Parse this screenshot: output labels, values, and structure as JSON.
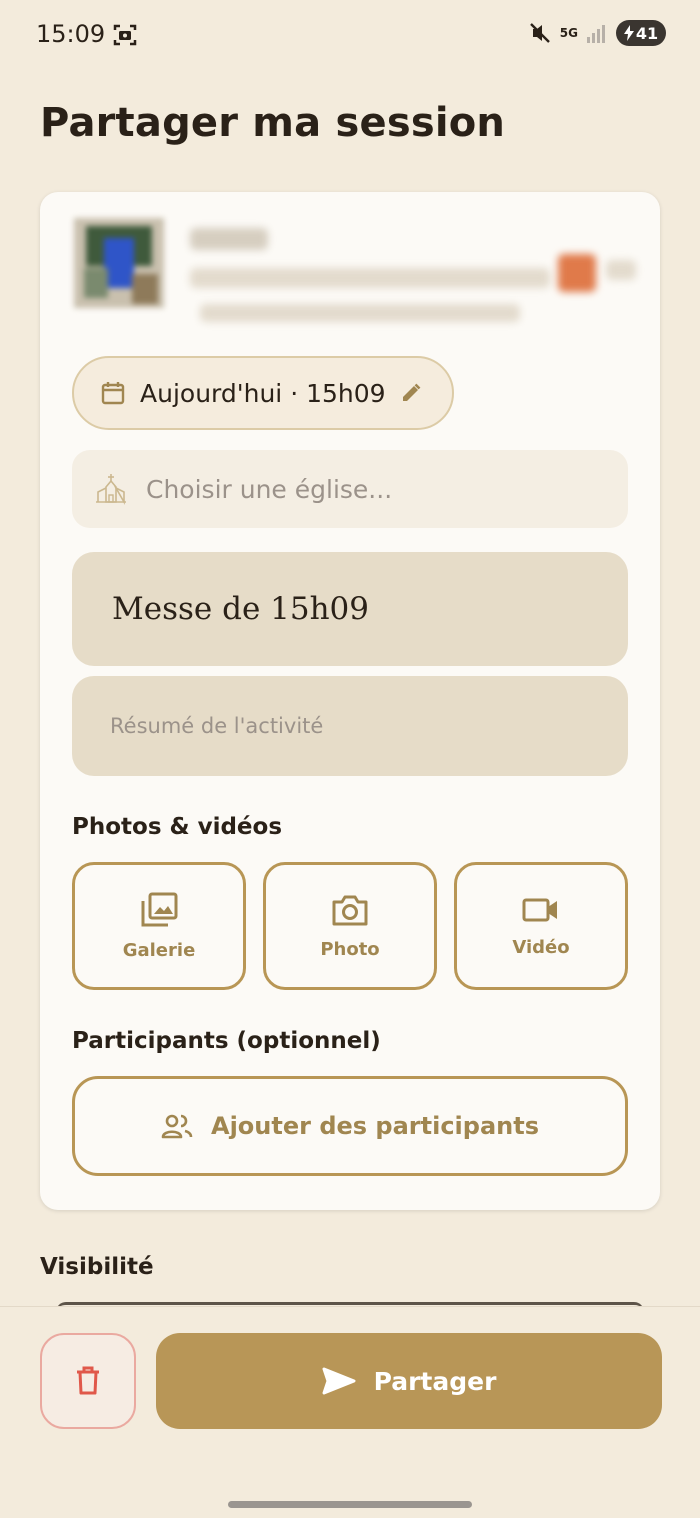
{
  "status_bar": {
    "time": "15:09",
    "network": "5G",
    "battery": "41",
    "icons": [
      "screenshot-icon",
      "mute-icon",
      "signal-icon",
      "battery-charging-icon"
    ]
  },
  "page": {
    "title": "Partager ma session"
  },
  "form": {
    "date_chip": "Aujourd'hui · 15h09",
    "church_placeholder": "Choisir une église...",
    "session_title": "Messe de 15h09",
    "summary_placeholder": "Résumé de l'activité"
  },
  "media": {
    "label": "Photos & vidéos",
    "buttons": [
      {
        "label": "Galerie",
        "icon": "gallery-icon"
      },
      {
        "label": "Photo",
        "icon": "camera-icon"
      },
      {
        "label": "Vidéo",
        "icon": "video-camera-icon"
      }
    ]
  },
  "participants": {
    "label": "Participants (optionnel)",
    "button_label": "Ajouter des participants"
  },
  "visibility": {
    "label": "Visibilité"
  },
  "actions": {
    "share_label": "Partager",
    "delete_icon": "trash-icon"
  },
  "colors": {
    "background": "#f3ebdc",
    "card": "#fcfaf6",
    "accent": "#b89657",
    "field": "#e6dcc8",
    "danger": "#e0584a"
  }
}
